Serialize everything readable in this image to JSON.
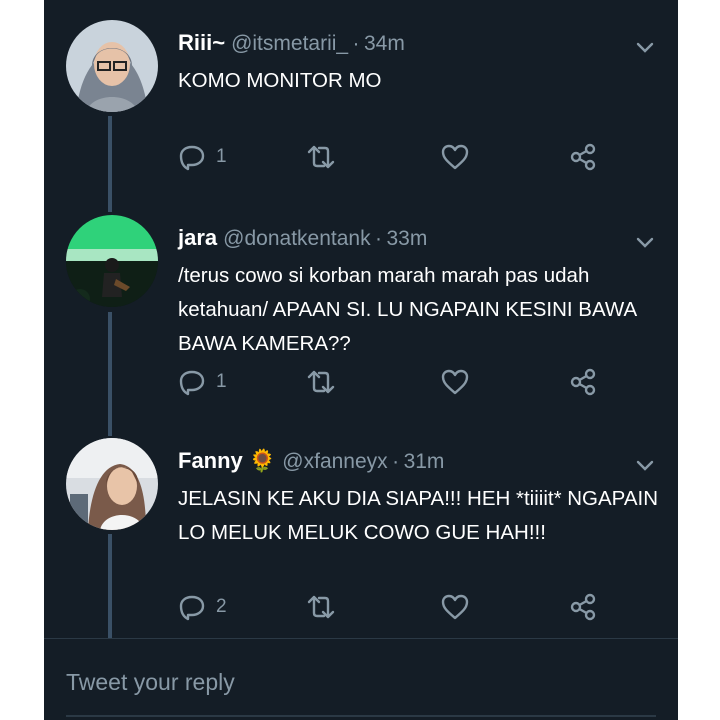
{
  "tweets": [
    {
      "name": "Riii~",
      "handle": "@itsmetarii_",
      "time": "34m",
      "text": "KOMO MONITOR MO",
      "reply_count": "1",
      "retweet_count": "",
      "like_count": ""
    },
    {
      "name": "jara",
      "handle": "@donatkentank",
      "time": "33m",
      "text": "/terus cowo si korban marah marah pas udah ketahuan/ APAAN SI. LU NGAPAIN KESINI BAWA BAWA KAMERA??",
      "reply_count": "1",
      "retweet_count": "",
      "like_count": ""
    },
    {
      "name": "Fanny 🌻",
      "handle": "@xfanneyx",
      "time": "31m",
      "text": "JELASIN KE AKU DIA SIAPA!!! HEH *tiiiit* NGAPAIN LO MELUK MELUK COWO GUE HAH!!!",
      "reply_count": "2",
      "retweet_count": "",
      "like_count": ""
    }
  ],
  "separator": "·",
  "reply_bar": {
    "placeholder": "Tweet your reply"
  },
  "icons": [
    "reply-icon",
    "retweet-icon",
    "like-icon",
    "share-icon",
    "chevron-down-icon"
  ],
  "colors": {
    "background": "#141d26",
    "text": "#ffffff",
    "muted": "#8899a6",
    "thread_line": "#3a5066"
  }
}
